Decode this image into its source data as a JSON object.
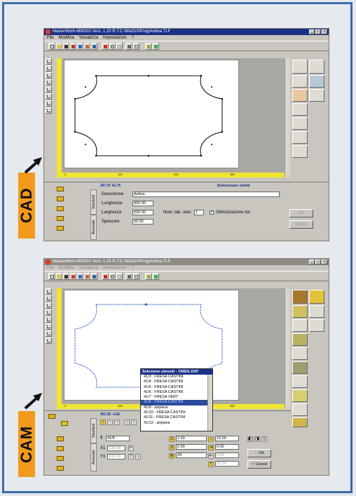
{
  "cad": {
    "tag": "CAD",
    "title": "MasterWork-MW310 Vers. 1.20 R.T.C.\\Mw310\\Prog\\Antina.TLF",
    "menu": [
      "File",
      "Modifica",
      "Visualizza",
      "Impostazioni",
      "?"
    ],
    "ruler_ticks": [
      "0",
      "100",
      "200",
      "300"
    ],
    "coords": "267.97  42.75",
    "status": "Selezionare entità",
    "tab_label": "Standard",
    "tab2_label": "Avanzate",
    "fields": {
      "descrizione_label": "Descrizione",
      "descrizione_value": "Antina",
      "lunghezza_label": "Lunghezza",
      "lunghezza_value": "800.00",
      "larghezza_label": "Larghezza",
      "larghezza_value": "500.00",
      "spessore_label": "Spessore",
      "spessore_value": "50.00",
      "num_tab_label": "Num. tab. utan.",
      "num_tab_value": "1",
      "ottimizzazione_label": "Ottimizzazione fori",
      "ottimizzazione_checked": "✓"
    },
    "btn_ok": "OK",
    "btn_cancel": "Cancel"
  },
  "cam": {
    "tag": "CAM",
    "title": "MasterWork-MW310 Vers. 1.20 R.T.C.\\Mw310\\Prog\\Antina.TLF",
    "menu": [
      "File",
      "Modifica",
      "Visualizza",
      "Impostazioni",
      "?"
    ],
    "coords": "451.95  -4.83",
    "tab_label": "Standard",
    "tab2_label": "Avanzate",
    "ruler_ticks": [
      "0",
      "100",
      "200",
      "300"
    ],
    "dropdown": {
      "title": "Selezione utensili - TAB01.DAT",
      "items": [
        "41/3 : FRESA CASTINI",
        "41/4 : FRESA CASTINI",
        "41/5 : FRESA CASTINI",
        "41/6 : FRESA CASTINI",
        "41/7 : FRESA    VERT",
        "41/8 : FRESA CASTINI",
        "41/9 : airplane",
        "41/10 : FRESA CASTINI",
        "41/11 : FRESA CASTINI",
        "41/12 : airplane"
      ],
      "selected_index": 5
    },
    "tool_field": "41/8",
    "x1_label": "X1",
    "x1_value": "136.00",
    "y1_label": "Y1",
    "y1_value": "102.00",
    "val_a": "2.00",
    "val_b": "5.00",
    "val_c": "24",
    "val_d": "10.00",
    "val_e": "0.00",
    "val_f": "0.00",
    "val_g": "22.00",
    "btn_ok": "OK",
    "btn_cancel": "Cancel"
  },
  "colors": {
    "frame": "#3e6aa8",
    "tag": "#f29a1d",
    "ruler": "#f2e630",
    "titlebar": "#1a2f86",
    "cam_path": "#4a6fd0"
  }
}
